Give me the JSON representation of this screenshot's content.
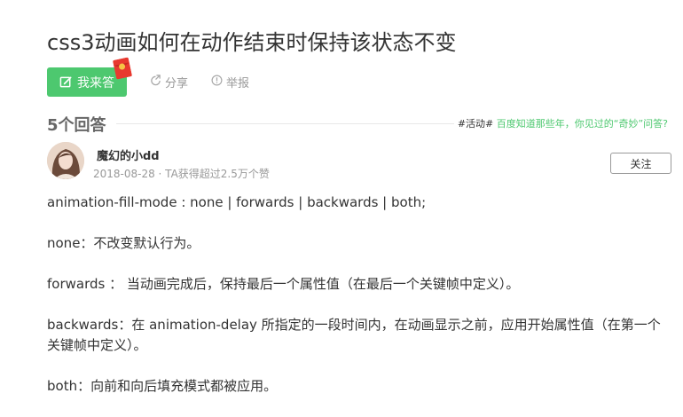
{
  "question": {
    "title": "css3动画如何在动作结束时保持该状态不变"
  },
  "actions": {
    "answer_label": "我来答",
    "share_label": "分享",
    "report_label": "举报"
  },
  "answers": {
    "count_label": "5个回答",
    "promo_tag": "#活动#",
    "promo_text": "百度知道那些年，你见过的“奇妙”问答?"
  },
  "answer": {
    "username": "魔幻的小dd",
    "meta": "2018-08-28 · TA获得超过2.5万个赞",
    "follow_label": "关注",
    "paragraphs": [
      "animation-fill-mode : none | forwards | backwards | both;",
      "none：不改变默认行为。",
      "forwards ： 当动画完成后，保持最后一个属性值（在最后一个关键帧中定义）。",
      "backwards：在 animation-delay 所指定的一段时间内，在动画显示之前，应用开始属性值（在第一个关键帧中定义）。",
      "both：向前和向后填充模式都被应用。"
    ]
  },
  "colors": {
    "accent_green": "#4dc86f",
    "muted_text": "#999999",
    "body_text": "#333333"
  },
  "icons": {
    "answer": "edit-icon",
    "share": "share-icon",
    "report": "report-icon",
    "badge": "red-packet-icon"
  }
}
